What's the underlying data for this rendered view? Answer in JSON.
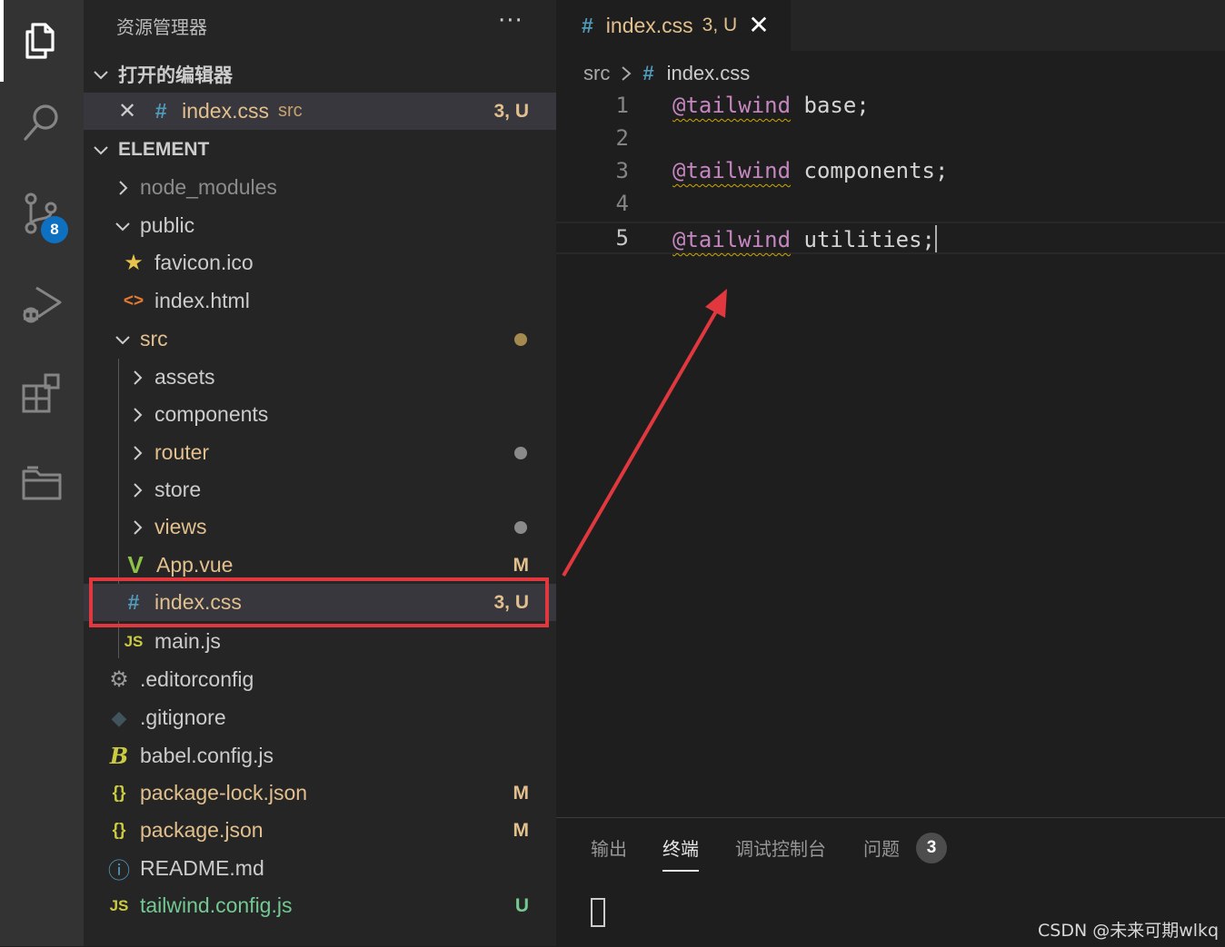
{
  "activity_bar": {
    "items": [
      {
        "icon": "files-icon",
        "active": true
      },
      {
        "icon": "search-icon"
      },
      {
        "icon": "source-control-icon",
        "badge": "8"
      },
      {
        "icon": "run-debug-icon"
      },
      {
        "icon": "extensions-icon"
      },
      {
        "icon": "folder-icon"
      }
    ]
  },
  "sidebar": {
    "title": "资源管理器",
    "more": "···",
    "open_editors": {
      "title": "打开的编辑器",
      "items": [
        {
          "name": "index.css",
          "path": "src",
          "status": "3, U"
        }
      ]
    },
    "workspace": {
      "title": "ELEMENT",
      "tree": [
        {
          "name": "node_modules",
          "type": "folder",
          "expanded": false
        },
        {
          "name": "public",
          "type": "folder",
          "expanded": true
        },
        {
          "name": "favicon.ico",
          "type": "file"
        },
        {
          "name": "index.html",
          "type": "file"
        },
        {
          "name": "src",
          "type": "folder",
          "expanded": true
        },
        {
          "name": "assets",
          "type": "folder"
        },
        {
          "name": "components",
          "type": "folder"
        },
        {
          "name": "router",
          "type": "folder"
        },
        {
          "name": "store",
          "type": "folder"
        },
        {
          "name": "views",
          "type": "folder"
        },
        {
          "name": "App.vue",
          "type": "file",
          "status": "M"
        },
        {
          "name": "index.css",
          "type": "file",
          "status": "3, U"
        },
        {
          "name": "main.js",
          "type": "file"
        },
        {
          "name": ".editorconfig",
          "type": "file"
        },
        {
          "name": ".gitignore",
          "type": "file"
        },
        {
          "name": "babel.config.js",
          "type": "file"
        },
        {
          "name": "package-lock.json",
          "type": "file",
          "status": "M"
        },
        {
          "name": "package.json",
          "type": "file",
          "status": "M"
        },
        {
          "name": "README.md",
          "type": "file"
        },
        {
          "name": "tailwind.config.js",
          "type": "file",
          "status": "U"
        }
      ]
    }
  },
  "editor": {
    "tab": {
      "name": "index.css",
      "status": "3, U",
      "close": "✕"
    },
    "breadcrumb": {
      "folder": "src",
      "file": "index.css"
    },
    "lines": [
      {
        "num": "1",
        "directive": "@tailwind",
        "arg": "base;"
      },
      {
        "num": "2",
        "directive": "",
        "arg": ""
      },
      {
        "num": "3",
        "directive": "@tailwind",
        "arg": "components;"
      },
      {
        "num": "4",
        "directive": "",
        "arg": ""
      },
      {
        "num": "5",
        "directive": "@tailwind",
        "arg": "utilities;"
      }
    ]
  },
  "panel": {
    "tabs": [
      "输出",
      "终端",
      "调试控制台",
      "问题"
    ],
    "active_tab": "终端",
    "problems_count": "3"
  },
  "watermark": "CSDN @未来可期wlkq",
  "colors": {
    "accent_highlight": "#e0383e",
    "untracked": "#73c991",
    "modified": "#e2c08d",
    "badge": "#0e70c0"
  }
}
